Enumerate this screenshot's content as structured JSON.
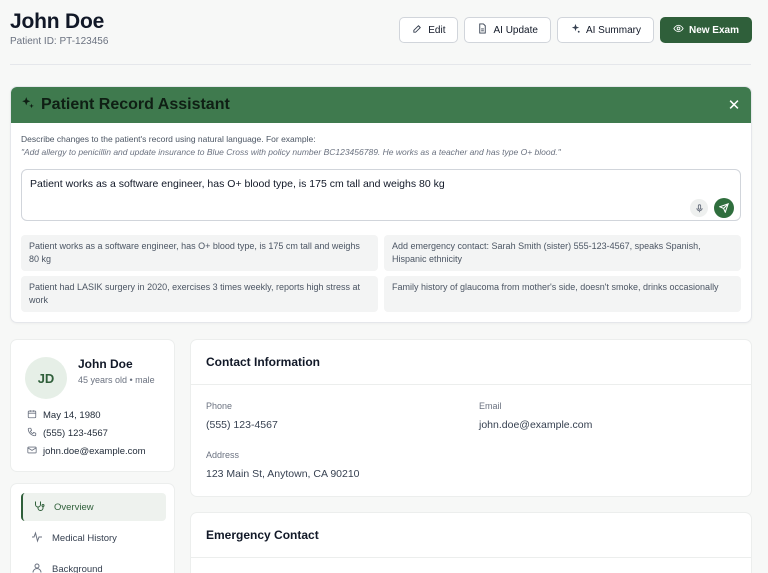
{
  "header": {
    "name": "John Doe",
    "patient_id": "Patient ID: PT-123456",
    "buttons": {
      "edit": "Edit",
      "ai_update": "AI Update",
      "ai_summary": "AI Summary",
      "new_exam": "New Exam"
    }
  },
  "assistant": {
    "title": "Patient Record Assistant",
    "description": "Describe changes to the patient's record using natural language. For example:",
    "example": "\"Add allergy to penicillin and update insurance to Blue Cross with policy number BC123456789. He works as a teacher and has type O+ blood.\"",
    "input_value": "Patient works as a software engineer, has O+ blood type, is 175 cm tall and weighs 80 kg",
    "suggestions": [
      "Patient works as a software engineer, has O+ blood type, is 175 cm tall and weighs 80 kg",
      "Add emergency contact: Sarah Smith (sister) 555-123-4567, speaks Spanish, Hispanic ethnicity",
      "Patient had LASIK surgery in 2020, exercises 3 times weekly, reports high stress at work",
      "Family history of glaucoma from mother's side, doesn't smoke, drinks occasionally"
    ]
  },
  "profile": {
    "initials": "JD",
    "name": "John Doe",
    "age_gender": "45 years old • male",
    "dob": "May 14, 1980",
    "phone": "(555) 123-4567",
    "email": "john.doe@example.com"
  },
  "nav": {
    "items": [
      {
        "label": "Overview",
        "icon": "stethoscope-icon"
      },
      {
        "label": "Medical History",
        "icon": "activity-icon"
      },
      {
        "label": "Background",
        "icon": "user-icon"
      }
    ]
  },
  "contact": {
    "title": "Contact Information",
    "phone_label": "Phone",
    "phone": "(555) 123-4567",
    "email_label": "Email",
    "email": "john.doe@example.com",
    "address_label": "Address",
    "address": "123 Main St, Anytown, CA 90210"
  },
  "emergency": {
    "title": "Emergency Contact"
  },
  "colors": {
    "brand": "#2f5f3a",
    "assistant_header": "#3f7a4e"
  }
}
